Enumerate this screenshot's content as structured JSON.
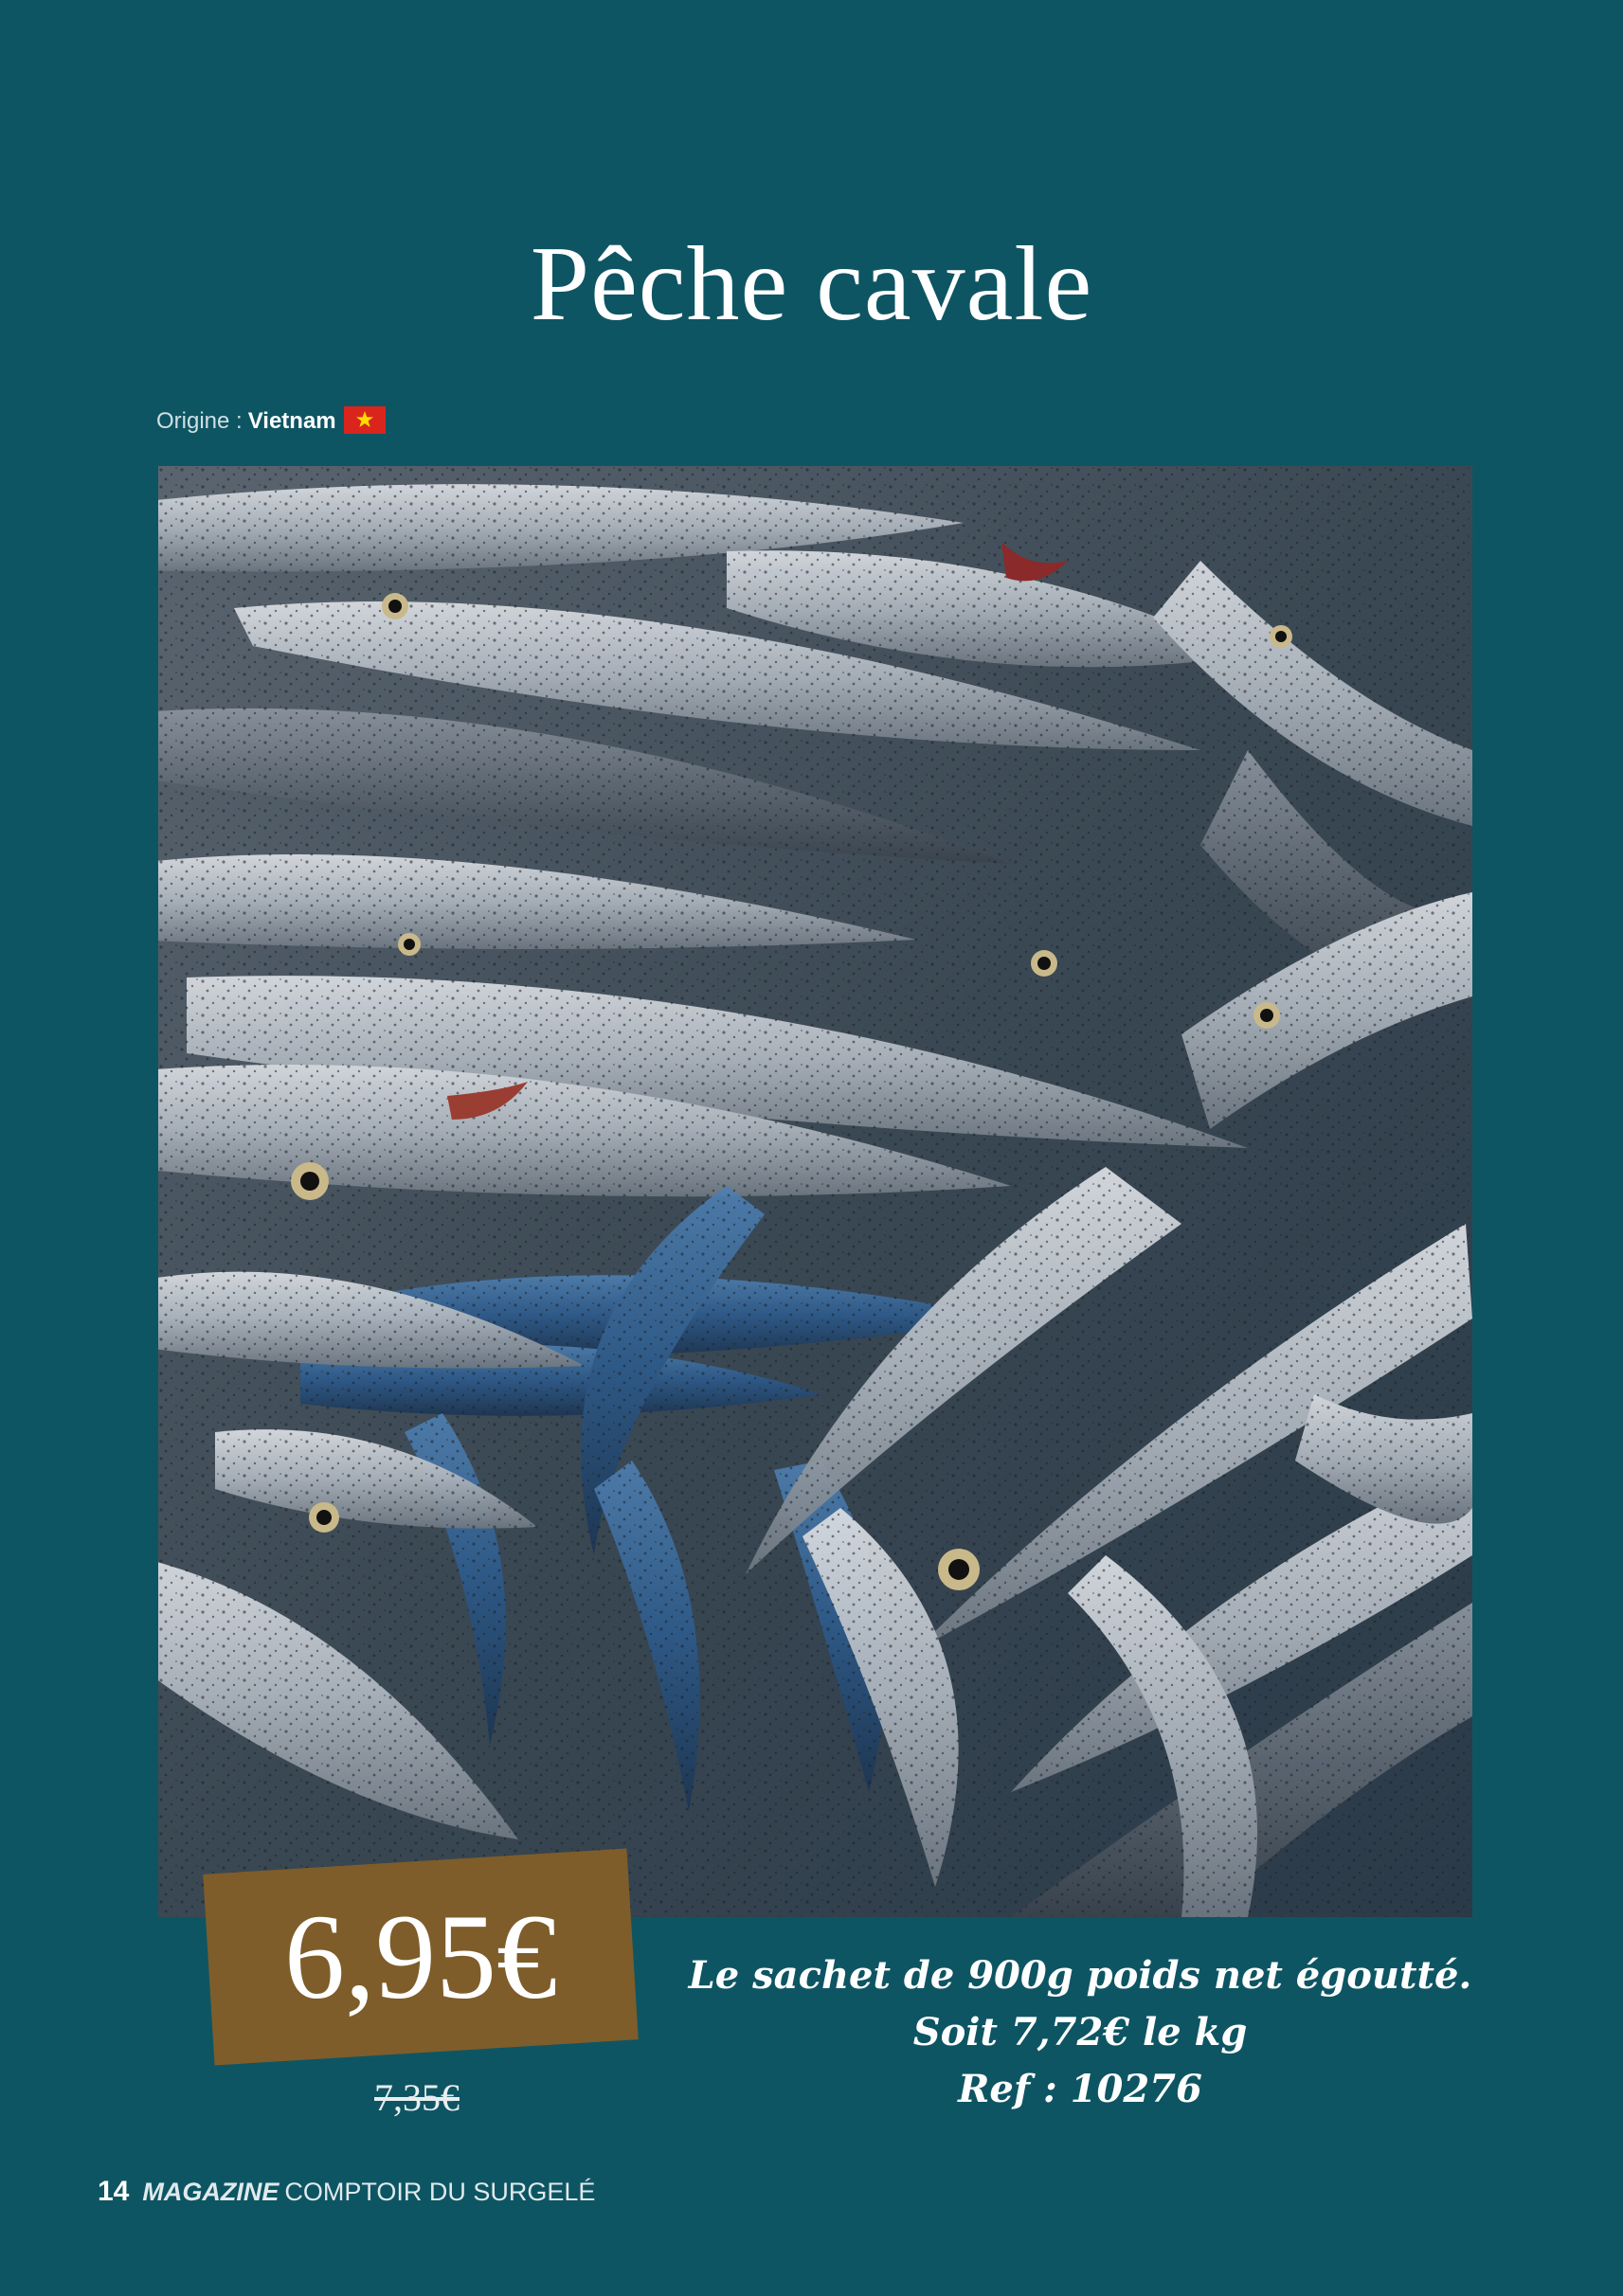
{
  "page": {
    "title": "Pêche cavale",
    "origin_label": "Origine :",
    "origin_country": "Vietnam",
    "origin_flag_icon": "vietnam-flag-icon",
    "photo_icon": "fish-photo",
    "price": "6,95€",
    "old_price": "7,35€",
    "description": [
      "Le sachet de 900g poids net égoutté.",
      "Soit 7,72€ le kg",
      "Ref : 10276"
    ]
  },
  "footer": {
    "page_number": "14",
    "magazine": "MAGAZINE",
    "brand": "COMPTOIR DU SURGELÉ"
  },
  "colors": {
    "background": "#0e5563",
    "price_box": "#7e5d2a",
    "flag_red": "#da251d",
    "flag_star": "#ffde00"
  }
}
